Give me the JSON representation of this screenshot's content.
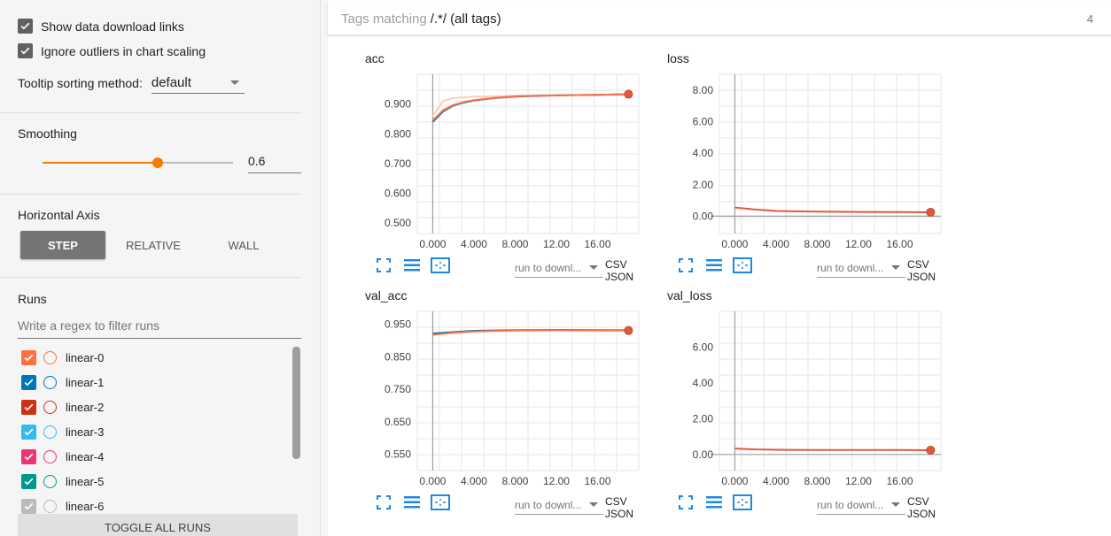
{
  "sidebar": {
    "show_download_links": "Show data download links",
    "ignore_outliers": "Ignore outliers in chart scaling",
    "tooltip_label": "Tooltip sorting method:",
    "tooltip_value": "default",
    "smoothing_title": "Smoothing",
    "smoothing_value": "0.6",
    "smoothing_fraction": 0.6,
    "horizontal_axis_title": "Horizontal Axis",
    "axis_buttons": [
      "STEP",
      "RELATIVE",
      "WALL"
    ],
    "runs_title": "Runs",
    "runs_filter_placeholder": "Write a regex to filter runs",
    "runs": [
      {
        "name": "linear-0",
        "color": "#ff7043"
      },
      {
        "name": "linear-1",
        "color": "#0077bb"
      },
      {
        "name": "linear-2",
        "color": "#cc3311"
      },
      {
        "name": "linear-3",
        "color": "#33bbee"
      },
      {
        "name": "linear-4",
        "color": "#ee3377"
      },
      {
        "name": "linear-5",
        "color": "#009988"
      },
      {
        "name": "linear-6",
        "color": "#bbbbbb"
      }
    ],
    "toggle_all": "TOGGLE ALL RUNS"
  },
  "header": {
    "prefix": "Tags matching",
    "pattern": "/.*/",
    "suffix": "(all tags)",
    "count": "4"
  },
  "cards": [
    {
      "title": "acc",
      "run_select": "run to downl...",
      "csv": "CSV",
      "json": "JSON"
    },
    {
      "title": "loss",
      "run_select": "run to downl...",
      "csv": "CSV",
      "json": "JSON"
    },
    {
      "title": "val_acc",
      "run_select": "run to downl...",
      "csv": "CSV",
      "json": "JSON"
    },
    {
      "title": "val_loss",
      "run_select": "run to downl...",
      "csv": "CSV",
      "json": "JSON"
    }
  ],
  "chart_data": [
    {
      "type": "line",
      "title": "acc",
      "x_ticks": [
        "0.000",
        "4.000",
        "8.000",
        "12.00",
        "16.00"
      ],
      "y_ticks": [
        "0.500",
        "0.600",
        "0.700",
        "0.800",
        "0.900"
      ],
      "xlim": [
        -1.5,
        20
      ],
      "ylim": [
        0.465,
        1.0
      ],
      "series": [
        {
          "values": [
            [
              0,
              0.84
            ],
            [
              1,
              0.875
            ],
            [
              2,
              0.895
            ],
            [
              3,
              0.905
            ],
            [
              4,
              0.912
            ],
            [
              6,
              0.92
            ],
            [
              8,
              0.925
            ],
            [
              10,
              0.927
            ],
            [
              12,
              0.929
            ],
            [
              14,
              0.93
            ],
            [
              16,
              0.931
            ],
            [
              19,
              0.933
            ]
          ]
        },
        {
          "values": [
            [
              0,
              0.845
            ],
            [
              1,
              0.879
            ],
            [
              2,
              0.897
            ],
            [
              3,
              0.907
            ],
            [
              4,
              0.913
            ],
            [
              6,
              0.921
            ],
            [
              8,
              0.926
            ],
            [
              10,
              0.928
            ],
            [
              12,
              0.929
            ],
            [
              14,
              0.93
            ],
            [
              16,
              0.931
            ],
            [
              19,
              0.933
            ]
          ]
        }
      ],
      "faint_series": [
        [
          0,
          0.86
        ],
        [
          1,
          0.91
        ],
        [
          2,
          0.92
        ],
        [
          4,
          0.925
        ],
        [
          8,
          0.928
        ],
        [
          12,
          0.93
        ],
        [
          16,
          0.931
        ],
        [
          19,
          0.933
        ]
      ],
      "end_marker": [
        19,
        0.933
      ]
    },
    {
      "type": "line",
      "title": "loss",
      "x_ticks": [
        "0.000",
        "4.000",
        "8.000",
        "12.00",
        "16.00"
      ],
      "y_ticks": [
        "0.00",
        "2.00",
        "4.00",
        "6.00",
        "8.00"
      ],
      "xlim": [
        -1.5,
        20
      ],
      "ylim": [
        -1.1,
        9.0
      ],
      "series": [
        {
          "values": [
            [
              0,
              0.55
            ],
            [
              2,
              0.42
            ],
            [
              4,
              0.33
            ],
            [
              8,
              0.29
            ],
            [
              12,
              0.27
            ],
            [
              16,
              0.26
            ],
            [
              19,
              0.25
            ]
          ]
        }
      ],
      "end_marker": [
        19,
        0.25
      ]
    },
    {
      "type": "line",
      "title": "val_acc",
      "x_ticks": [
        "0.000",
        "4.000",
        "8.000",
        "12.00",
        "16.00"
      ],
      "y_ticks": [
        "0.550",
        "0.650",
        "0.750",
        "0.850",
        "0.950"
      ],
      "xlim": [
        -1.5,
        20
      ],
      "ylim": [
        0.5,
        0.99
      ],
      "series": [
        {
          "values": [
            [
              0,
              0.922
            ],
            [
              2,
              0.926
            ],
            [
              4,
              0.93
            ],
            [
              8,
              0.932
            ],
            [
              12,
              0.933
            ],
            [
              16,
              0.932
            ],
            [
              19,
              0.932
            ]
          ]
        },
        {
          "values": [
            [
              0,
              0.918
            ],
            [
              2,
              0.924
            ],
            [
              4,
              0.928
            ],
            [
              8,
              0.931
            ],
            [
              12,
              0.932
            ],
            [
              16,
              0.931
            ],
            [
              19,
              0.931
            ]
          ]
        }
      ],
      "end_marker": [
        19,
        0.931
      ]
    },
    {
      "type": "line",
      "title": "val_loss",
      "x_ticks": [
        "0.000",
        "4.000",
        "8.000",
        "12.00",
        "16.00"
      ],
      "y_ticks": [
        "0.00",
        "2.00",
        "4.00",
        "6.00"
      ],
      "xlim": [
        -1.5,
        20
      ],
      "ylim": [
        -0.9,
        8.0
      ],
      "series": [
        {
          "values": [
            [
              0,
              0.33
            ],
            [
              2,
              0.28
            ],
            [
              4,
              0.26
            ],
            [
              8,
              0.25
            ],
            [
              12,
              0.25
            ],
            [
              16,
              0.25
            ],
            [
              19,
              0.24
            ]
          ]
        }
      ],
      "end_marker": [
        19,
        0.24
      ]
    }
  ]
}
